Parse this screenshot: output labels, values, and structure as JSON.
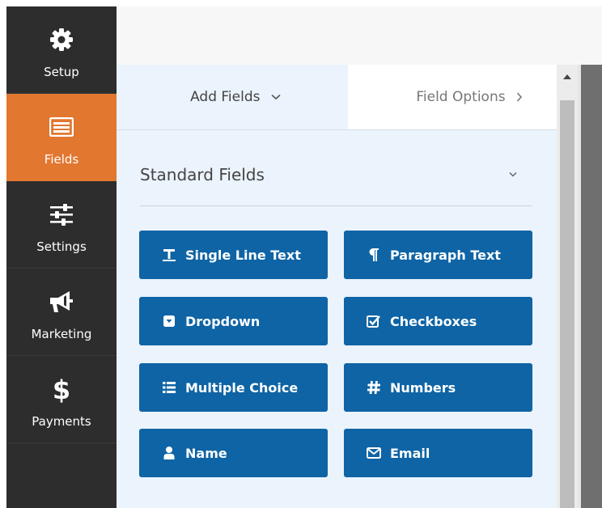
{
  "sidebar": {
    "items": [
      {
        "label": "Setup",
        "icon": "gear-icon"
      },
      {
        "label": "Fields",
        "icon": "fields-list-icon",
        "active": true
      },
      {
        "label": "Settings",
        "icon": "sliders-icon"
      },
      {
        "label": "Marketing",
        "icon": "megaphone-icon"
      },
      {
        "label": "Payments",
        "icon": "dollar-icon"
      }
    ],
    "active_color": "#e27730",
    "background": "#2d2d2d"
  },
  "tabs": {
    "add_fields": "Add Fields",
    "field_options": "Field Options"
  },
  "section": {
    "title": "Standard Fields"
  },
  "fields": [
    {
      "label": "Single Line Text",
      "icon": "text-icon"
    },
    {
      "label": "Paragraph Text",
      "icon": "paragraph-icon"
    },
    {
      "label": "Dropdown",
      "icon": "dropdown-icon"
    },
    {
      "label": "Checkboxes",
      "icon": "checkbox-icon"
    },
    {
      "label": "Multiple Choice",
      "icon": "list-icon"
    },
    {
      "label": "Numbers",
      "icon": "hash-icon"
    },
    {
      "label": "Name",
      "icon": "user-icon"
    },
    {
      "label": "Email",
      "icon": "envelope-icon"
    }
  ],
  "colors": {
    "button": "#0e64a5",
    "panel": "#ebf3fc"
  }
}
